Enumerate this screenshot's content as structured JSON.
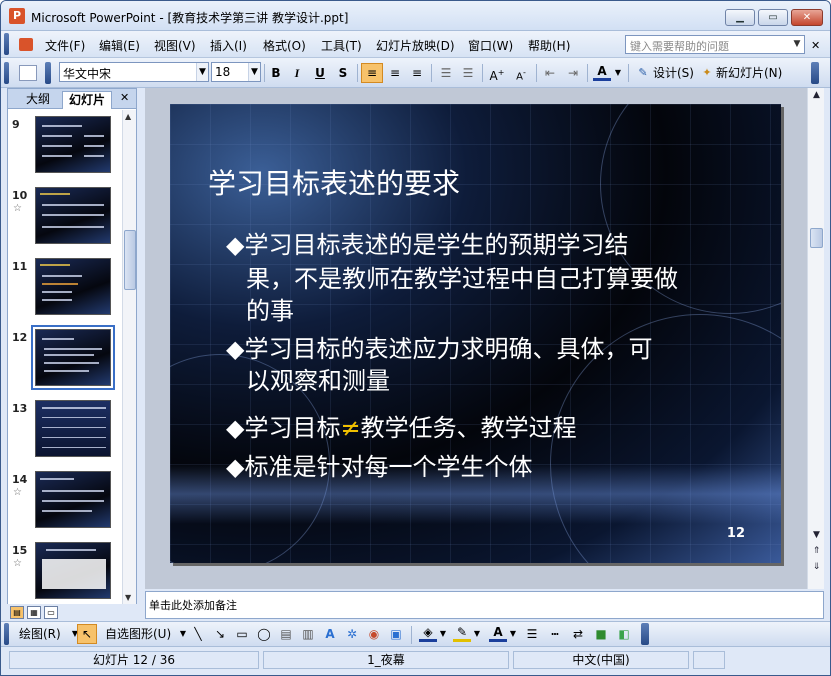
{
  "window": {
    "title": "Microsoft PowerPoint - [教育技术学第三讲 教学设计.ppt]",
    "app_icon": "P",
    "minimize": "▁",
    "maximize": "▭",
    "close": "✕"
  },
  "menubar": {
    "items": [
      "文件(F)",
      "编辑(E)",
      "视图(V)",
      "插入(I)",
      "格式(O)",
      "工具(T)",
      "幻灯片放映(D)",
      "窗口(W)",
      "帮助(H)"
    ],
    "help_placeholder": "键入需要帮助的问题"
  },
  "toolbar": {
    "font_name": "华文中宋",
    "font_size": "18",
    "bold": "B",
    "italic": "I",
    "underline": "U",
    "shadow": "S",
    "align_left": "≡",
    "align_center": "≡",
    "align_right": "≡",
    "design_label": "设计(S)",
    "new_slide_label": "新幻灯片(N)"
  },
  "left_pane": {
    "tab_outline": "大纲",
    "tab_slides": "幻灯片",
    "close": "✕",
    "thumbnails": [
      {
        "num": "9",
        "star": ""
      },
      {
        "num": "10",
        "star": "☆"
      },
      {
        "num": "11",
        "star": ""
      },
      {
        "num": "12",
        "star": ""
      },
      {
        "num": "13",
        "star": ""
      },
      {
        "num": "14",
        "star": "☆"
      },
      {
        "num": "15",
        "star": "☆"
      }
    ]
  },
  "slide": {
    "title": "学习目标表述的要求",
    "bullet1_line1": "◆学习目标表述的是学生的预期学习结",
    "bullet1_line2": "果，不是教师在教学过程中自己打算要做",
    "bullet1_line3": "的事",
    "bullet2_line1": "◆学习目标的表述应力求明确、具体，可",
    "bullet2_line2": "以观察和测量",
    "bullet3_pre": "◆学习目标",
    "bullet3_neq": "≠",
    "bullet3_post": "教学任务、教学过程",
    "bullet4": "◆标准是针对每一个学生个体",
    "page_number": "12"
  },
  "notes": {
    "placeholder": "单击此处添加备注"
  },
  "drawbar": {
    "draw_label": "绘图(R)",
    "autoshape_label": "自选图形(U)"
  },
  "statusbar": {
    "slide_info": "幻灯片 12 / 36",
    "design": "1_夜幕",
    "language": "中文(中国)"
  }
}
